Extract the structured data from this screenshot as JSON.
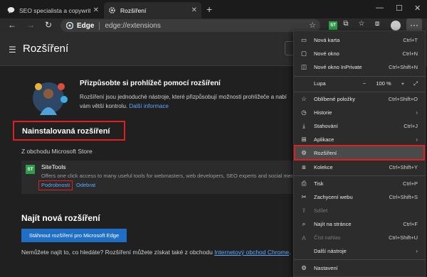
{
  "tabs": [
    {
      "title": "SEO specialista a copywriter Dar",
      "icon": "speech-bubble-icon"
    },
    {
      "title": "Rozšíření",
      "icon": "gear-icon"
    }
  ],
  "address": {
    "badge": "Edge",
    "url": "edge://extensions"
  },
  "toolbar": {
    "extension_badge": "ST",
    "more_label": "···"
  },
  "page": {
    "title": "Rozšíření"
  },
  "promo": {
    "title": "Přizpůsobte si prohlížeč pomocí rozšíření",
    "text": "Rozšíření jsou jednoduché nástroje, které přizpůsobují možnosti prohlížeče a nabí",
    "text2": "vám větší kontrolu.",
    "link": "Další informace"
  },
  "installed": {
    "title": "Nainstalovaná rozšíření",
    "store_label": "Z obchodu Microsoft Store",
    "extension": {
      "badge": "ST",
      "name": "SiteTools",
      "description": "Offers one click access to many useful tools for webmasters, web developers, SEO experts and social media mark",
      "details": "Podrobnosti",
      "remove": "Odebrat"
    }
  },
  "find": {
    "title": "Najít nová rozšíření",
    "button": "Stáhnout rozšíření pro Microsoft Edge",
    "not_found": "Nemůžete najít to, co hledáte? Rozšíření můžete získat také z obchodu ",
    "store_link": "Internetový obchod Chrome",
    "period": "."
  },
  "menu": {
    "items": [
      {
        "label": "Nová karta",
        "shortcut": "Ctrl+T",
        "icon": "new-tab-icon"
      },
      {
        "label": "Nové okno",
        "shortcut": "Ctrl+N",
        "icon": "new-window-icon"
      },
      {
        "label": "Nové okno InPrivate",
        "shortcut": "Ctrl+Shift+N",
        "icon": "inprivate-icon"
      },
      {
        "label": "Oblíbené položky",
        "shortcut": "Ctrl+Shift+O",
        "icon": "favorites-icon"
      },
      {
        "label": "Historie",
        "shortcut": "",
        "icon": "history-icon",
        "submenu": true
      },
      {
        "label": "Stahování",
        "shortcut": "Ctrl+J",
        "icon": "download-icon"
      },
      {
        "label": "Aplikace",
        "shortcut": "",
        "icon": "apps-icon",
        "submenu": true
      },
      {
        "label": "Rozšíření",
        "shortcut": "",
        "icon": "extensions-icon",
        "highlighted": true
      },
      {
        "label": "Kolekce",
        "shortcut": "Ctrl+Shift+Y",
        "icon": "collections-icon"
      },
      {
        "label": "Tisk",
        "shortcut": "Ctrl+P",
        "icon": "print-icon"
      },
      {
        "label": "Zachycení webu",
        "shortcut": "Ctrl+Shift+S",
        "icon": "web-capture-icon"
      },
      {
        "label": "Sdílet",
        "shortcut": "",
        "icon": "share-icon",
        "disabled": true
      },
      {
        "label": "Najít na stránce",
        "shortcut": "Ctrl+F",
        "icon": "find-icon"
      },
      {
        "label": "Číst nahlas",
        "shortcut": "Ctrl+Shift+U",
        "icon": "read-aloud-icon",
        "disabled": true
      },
      {
        "label": "Další nástroje",
        "shortcut": "",
        "icon": "",
        "submenu": true
      },
      {
        "label": "Nastavení",
        "shortcut": "",
        "icon": "settings-icon"
      }
    ],
    "zoom": {
      "label": "Lupa",
      "minus": "−",
      "value": "100 %",
      "plus": "+",
      "fullscreen": "⤢"
    }
  }
}
